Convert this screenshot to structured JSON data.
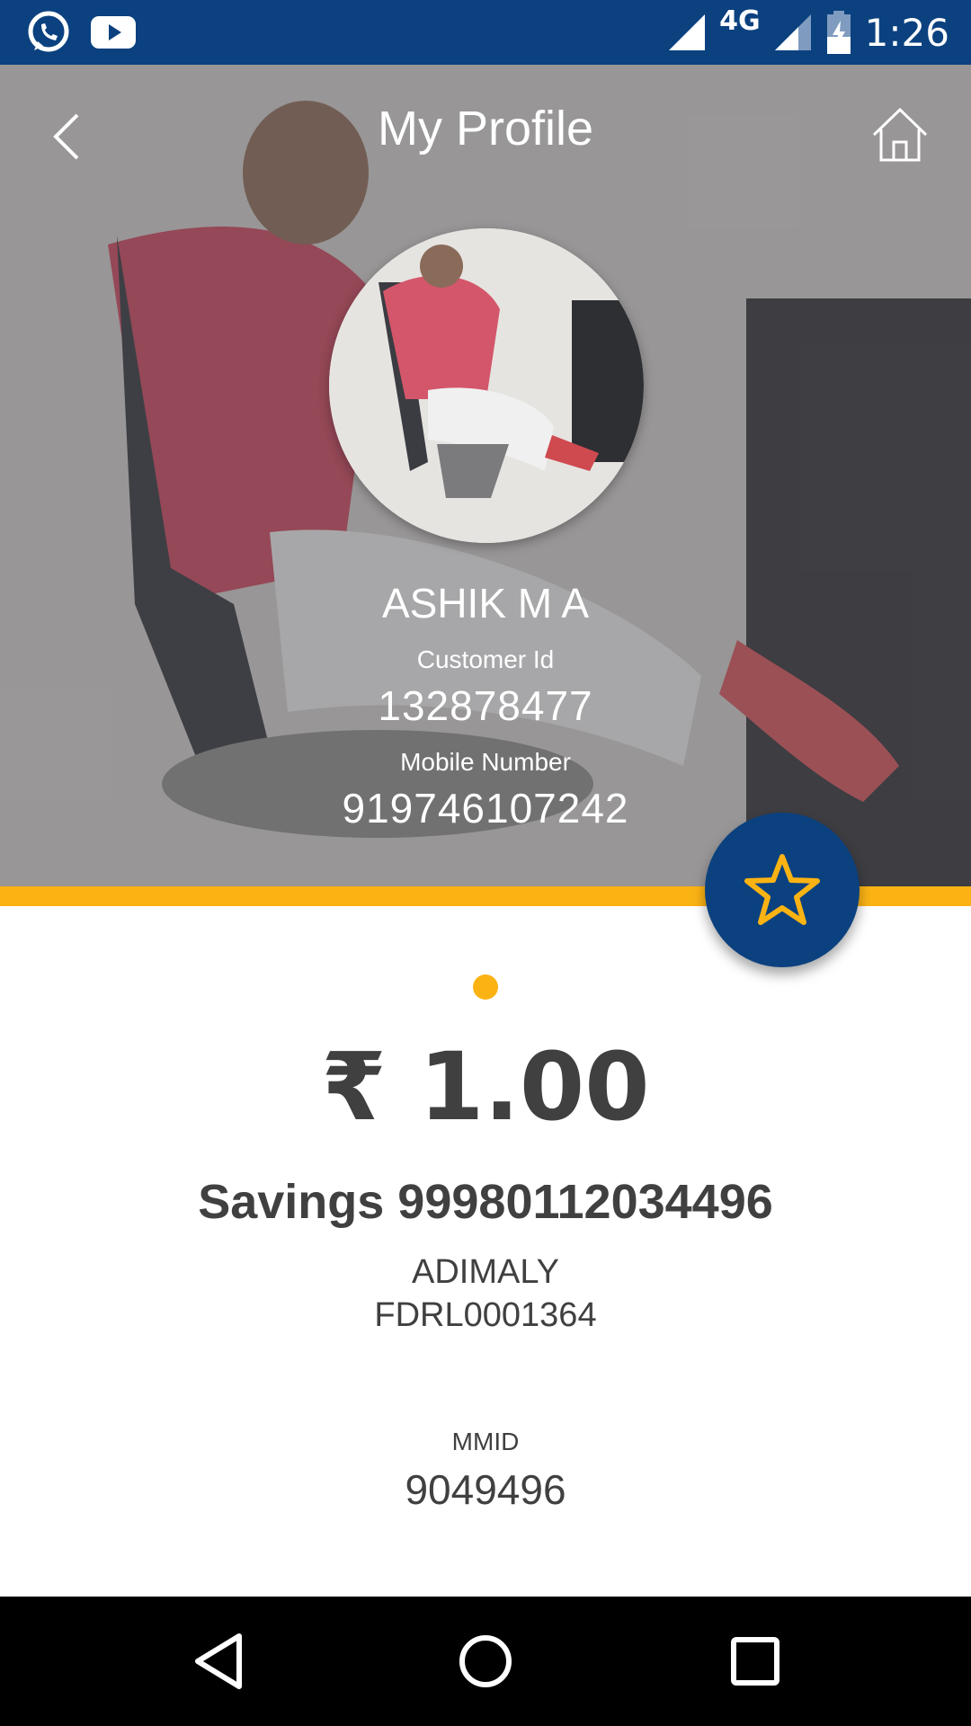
{
  "status_bar": {
    "network": "4G",
    "time": "1:26",
    "icons": [
      "whatsapp-icon",
      "youtube-icon",
      "signal-icon",
      "signal-icon",
      "battery-charging-icon"
    ]
  },
  "header": {
    "title": "My Profile",
    "back_icon": "chevron-left-icon",
    "home_icon": "home-icon"
  },
  "profile": {
    "name": "ASHIK M A",
    "customer_id_label": "Customer Id",
    "customer_id": "132878477",
    "mobile_label": "Mobile Number",
    "mobile": "919746107242"
  },
  "fab_icon": "star-icon",
  "account": {
    "balance": "₹ 1.00",
    "title": "Savings 99980112034496",
    "branch": "ADIMALY",
    "ifsc": "FDRL0001364",
    "mmid_label": "MMID",
    "mmid": "9049496"
  },
  "colors": {
    "primary": "#0b417f",
    "accent": "#fbb314",
    "text": "#404040"
  }
}
